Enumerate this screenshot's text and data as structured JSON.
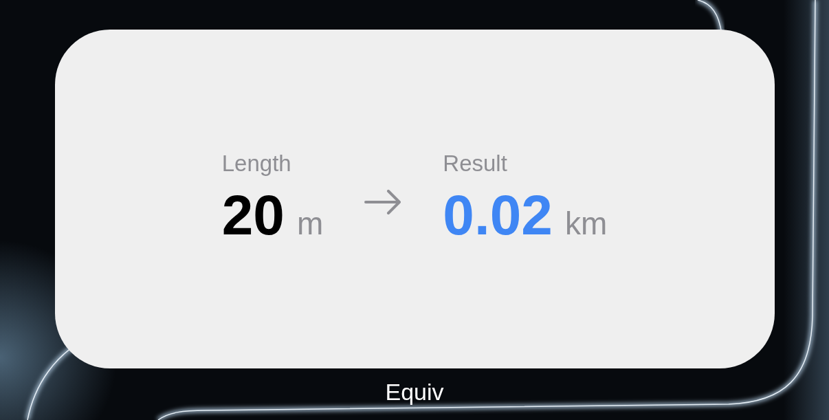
{
  "widget": {
    "input": {
      "label": "Length",
      "value": "20",
      "unit": "m"
    },
    "output": {
      "label": "Result",
      "value": "0.02",
      "unit": "km"
    }
  },
  "app_label": "Equiv"
}
